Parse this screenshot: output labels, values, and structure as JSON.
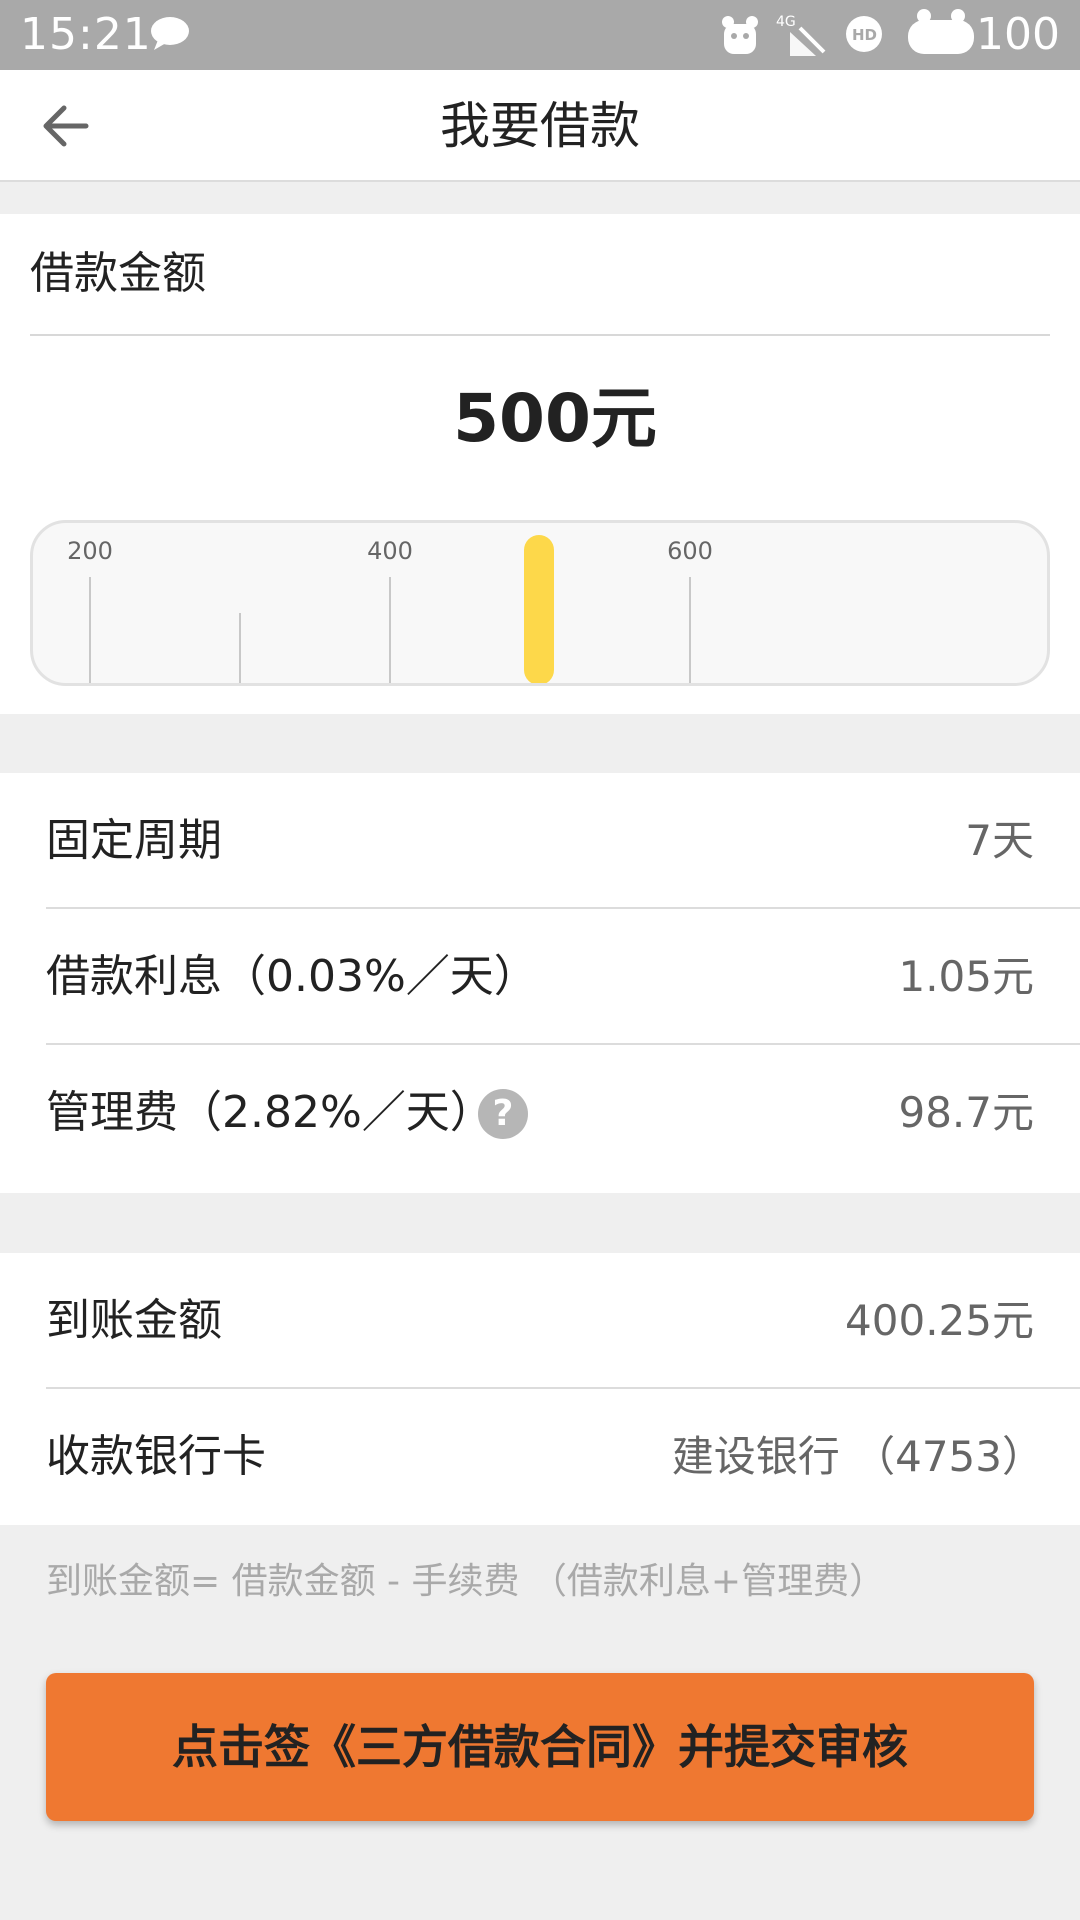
{
  "status_bar": {
    "time": "15:21",
    "battery": "100",
    "icons": [
      "message-icon",
      "pet-notification-icon",
      "4g-signal-icon",
      "hd-icon",
      "battery-icon"
    ]
  },
  "header": {
    "title": "我要借款",
    "back_icon": "arrow-left-icon"
  },
  "amount": {
    "label": "借款金额",
    "value": "500元",
    "selected_amount": 500,
    "slider_ticks": [
      "200",
      "400",
      "600"
    ],
    "handle_color": "#fdd84a"
  },
  "details": [
    {
      "label": "固定周期",
      "value": "7天"
    },
    {
      "label": "借款利息（0.03%／天）",
      "value": "1.05元"
    },
    {
      "label": "管理费（2.82%／天）",
      "value": "98.7元",
      "help": "?"
    }
  ],
  "payout": [
    {
      "label": "到账金额",
      "value": "400.25元"
    },
    {
      "label": "收款银行卡",
      "value": "建设银行 （4753）"
    }
  ],
  "formula_note": "到账金额= 借款金额 - 手续费 （借款利息+管理费）",
  "submit": {
    "label": "点击签《三方借款合同》并提交审核",
    "color": "#ef7831"
  }
}
